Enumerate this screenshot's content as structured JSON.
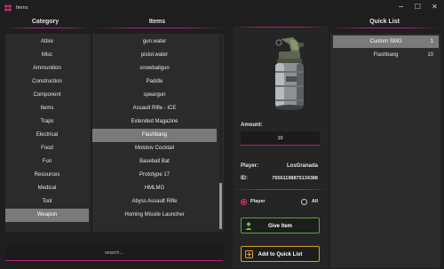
{
  "window": {
    "title": "Items"
  },
  "category": {
    "header": "Category",
    "items": [
      "Attire",
      "Misc",
      "Ammunition",
      "Construction",
      "Component",
      "Items",
      "Traps",
      "Electrical",
      "Food",
      "Fun",
      "Resources",
      "Medical",
      "Tool",
      "Weapon"
    ],
    "selected": "Weapon"
  },
  "items": {
    "header": "Items",
    "list": [
      "gun.water",
      "pistol.water",
      "snowballgun",
      "Paddle",
      "speargun",
      "Assault Rifle - ICE",
      "Extended Magazine",
      "Flashbang",
      "Molotov Cocktail",
      "Baseball Bat",
      "Prototype 17",
      "HMLMG",
      "Abyss Assault Rifle",
      "Homing Missile Launcher"
    ],
    "selected": "Flashbang",
    "search_placeholder": "search..."
  },
  "detail": {
    "amount_label": "Amount:",
    "amount_value": "10",
    "player_label": "Player:",
    "player_value": "LosGranada",
    "id_label": "ID:",
    "id_value": "76561198875134388",
    "radio_player": "Player",
    "radio_all": "All",
    "radio_selected": "Player",
    "give_button": "Give Item",
    "add_button": "Add to Quick List"
  },
  "quick_list": {
    "header": "Quick List",
    "entries": [
      {
        "name": "Custom SMG",
        "count": "1",
        "selected": true
      },
      {
        "name": "Flashbang",
        "count": "10",
        "selected": false
      }
    ]
  },
  "colors": {
    "accent": "#b0207c",
    "selected_row": "#7a7a7a",
    "give_border": "#5fa33d",
    "add_border": "#d7a01c"
  },
  "icons": [
    "app-logo-icon",
    "minimize-icon",
    "maximize-icon",
    "close-icon",
    "user-add-icon",
    "list-add-icon"
  ]
}
